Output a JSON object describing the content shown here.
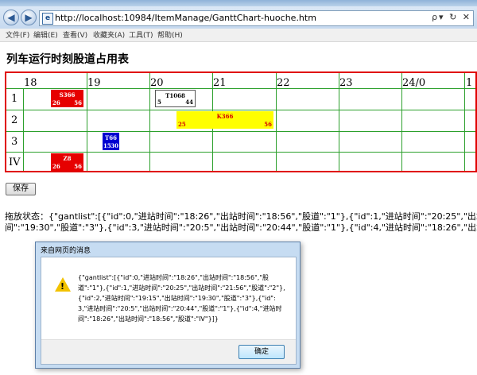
{
  "browser": {
    "url": "http://localhost:10984/ItemManage/GanttChart-huoche.htm",
    "tools": "ρ▾ ↻ ✕",
    "menu": [
      "文件(F)",
      "编辑(E)",
      "查看(V)",
      "收藏夹(A)",
      "工具(T)",
      "帮助(H)"
    ]
  },
  "page": {
    "title": "列车运行时刻股道占用表",
    "hours": [
      "18",
      "19",
      "20",
      "21",
      "22",
      "23",
      "24/0",
      "1"
    ],
    "tracks": [
      "1",
      "2",
      "3",
      "IV"
    ],
    "bars": [
      {
        "name": "S366",
        "in": "26",
        "out": "56",
        "bg": "#e60000",
        "fg": "#ffffff"
      },
      {
        "name": "T1068",
        "in": "5",
        "out": "44",
        "bg": "#ffffff",
        "fg": "#000000"
      },
      {
        "name": "K366",
        "in": "25",
        "out": "56",
        "bg": "#ffff00",
        "fg": "#d40000"
      },
      {
        "name": "T66",
        "in": "15",
        "out": "30",
        "bg": "#0000d0",
        "fg": "#ffffff"
      },
      {
        "name": "Z8",
        "in": "26",
        "out": "56",
        "bg": "#e60000",
        "fg": "#ffffff"
      }
    ],
    "save_label": "保存",
    "status_line1": "拖放状态：{\"gantlist\":[{\"id\":0,\"进站时间\":\"18:26\",\"出站时间\":\"18:56\",\"股道\":\"1\"},{\"id\":1,\"进站时间\":\"20:25\",\"出站时",
    "status_line2": "间\":\"19:30\",\"股道\":\"3\"},{\"id\":3,\"进站时间\":\"20:5\",\"出站时间\":\"20:44\",\"股道\":\"1\"},{\"id\":4,\"进站时间\":\"18:26\",\"出站"
  },
  "dialog": {
    "title": "来自网页的消息",
    "message": "{\"gantlist\":[{\"id\":0,\"进站时间\":\"18:26\",\"出站时间\":\"18:56\",\"股道\":\"1\"},{\"id\":1,\"进站时间\":\"20:25\",\"出站时间\":\"21:56\",\"股道\":\"2\"},{\"id\":2,\"进站时间\":\"19:15\",\"出站时间\":\"19:30\",\"股道\":\"3\"},{\"id\":3,\"进站时间\":\"20:5\",\"出站时间\":\"20:44\",\"股道\":\"1\"},{\"id\":4,\"进站时间\":\"18:26\",\"出站时间\":\"18:56\",\"股道\":\"IV\"}]}",
    "ok_label": "确定"
  }
}
